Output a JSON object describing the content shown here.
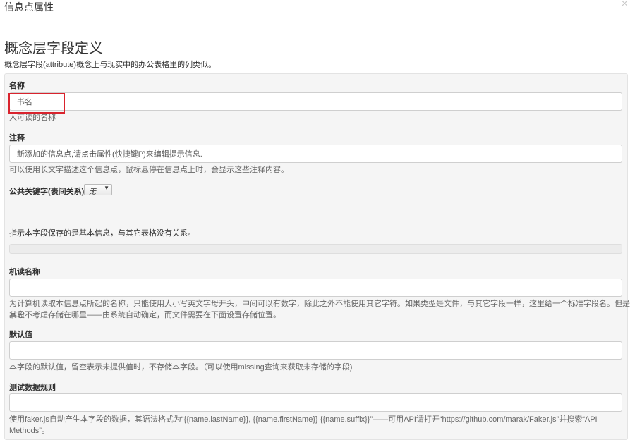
{
  "modal": {
    "title": "信息点属性",
    "close_label": "×"
  },
  "section": {
    "title": "概念层字段定义",
    "description": "概念层字段(attribute)概念上与现实中的办公表格里的列类似。"
  },
  "fields": {
    "name": {
      "label": "名称",
      "value": "书名",
      "help": "人可读的名称"
    },
    "comment": {
      "label": "注释",
      "value": "新添加的信息点,请点击属性(快捷键P)来编辑提示信息.",
      "help": "可以使用长文字描述这个信息点，鼠标悬停在信息点上时，会显示这些注释内容。"
    },
    "public_key": {
      "label": "公共关键字(表间关系)",
      "selected": "无",
      "help": "指示本字段保存的是基本信息，与其它表格没有关系。"
    },
    "machine_name": {
      "label": "机读名称",
      "value": "",
      "help_line1": "为计算机读取本信息点所起的名称，只能使用大小写英文字母开头，中间可以有数字，除此之外不能使用其它字符。如果类型是文件，与其它字段一样，这里给一个标准字段名。但是其它",
      "help_line2": "字段不考虑存储在哪里——由系统自动确定，而文件需要在下面设置存储位置。"
    },
    "default_value": {
      "label": "默认值",
      "value": "",
      "help": "本字段的默认值，留空表示未提供值时，不存储本字段。（可以使用missing查询来获取未存储的字段)"
    },
    "test_rule": {
      "label": "测试数据规则",
      "value": "",
      "help": "使用faker.js自动产生本字段的数据，其语法格式为“{{name.lastName}}, {{name.firstName}} {{name.suffix}}”——可用API请打开“https://github.com/marak/Faker.js”并搜索“API Methods”。"
    }
  },
  "colors": {
    "highlight": "#d9232d",
    "well_bg": "#f5f5f5"
  }
}
